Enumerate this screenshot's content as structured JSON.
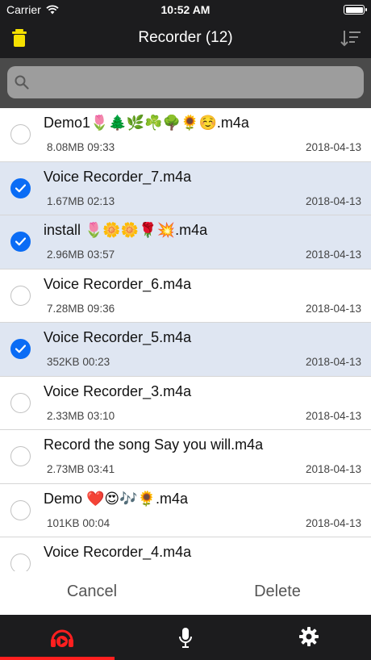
{
  "status_bar": {
    "carrier": "Carrier",
    "time": "10:52 AM"
  },
  "nav": {
    "title": "Recorder (12)",
    "left_icon": "trash-icon",
    "right_icon": "sort-icon"
  },
  "search": {
    "placeholder": "",
    "value": ""
  },
  "recordings": [
    {
      "name": "Demo1🌷🌲🌿☘️🌳🌻☺️.m4a",
      "size": "8.08MB",
      "duration": "09:33",
      "date": "2018-04-13",
      "selected": false
    },
    {
      "name": "Voice Recorder_7.m4a",
      "size": "1.67MB",
      "duration": "02:13",
      "date": "2018-04-13",
      "selected": true
    },
    {
      "name": "install 🌷🌼🌼🌹💥.m4a",
      "size": "2.96MB",
      "duration": "03:57",
      "date": "2018-04-13",
      "selected": true
    },
    {
      "name": "Voice Recorder_6.m4a",
      "size": "7.28MB",
      "duration": "09:36",
      "date": "2018-04-13",
      "selected": false
    },
    {
      "name": "Voice Recorder_5.m4a",
      "size": "352KB",
      "duration": "00:23",
      "date": "2018-04-13",
      "selected": true
    },
    {
      "name": "Voice Recorder_3.m4a",
      "size": "2.33MB",
      "duration": "03:10",
      "date": "2018-04-13",
      "selected": false
    },
    {
      "name": "Record the song Say you will.m4a",
      "size": "2.73MB",
      "duration": "03:41",
      "date": "2018-04-13",
      "selected": false
    },
    {
      "name": "Demo ❤️😍🎶🌻.m4a",
      "size": "101KB",
      "duration": "00:04",
      "date": "2018-04-13",
      "selected": false
    },
    {
      "name": "Voice Recorder_4.m4a",
      "size": "",
      "duration": "",
      "date": "",
      "selected": false
    }
  ],
  "actions": {
    "cancel": "Cancel",
    "delete": "Delete"
  },
  "tabs": [
    {
      "icon": "headphones-play-icon",
      "active": true
    },
    {
      "icon": "microphone-icon",
      "active": false
    },
    {
      "icon": "gear-icon",
      "active": false
    }
  ],
  "colors": {
    "bar_background": "#1c1c1e",
    "search_background": "#4a4a4a",
    "selected_row": "#dfe6f2",
    "checkmark": "#0a6cf5",
    "trash": "#f5e000",
    "active_tab": "#ff1f1f"
  }
}
